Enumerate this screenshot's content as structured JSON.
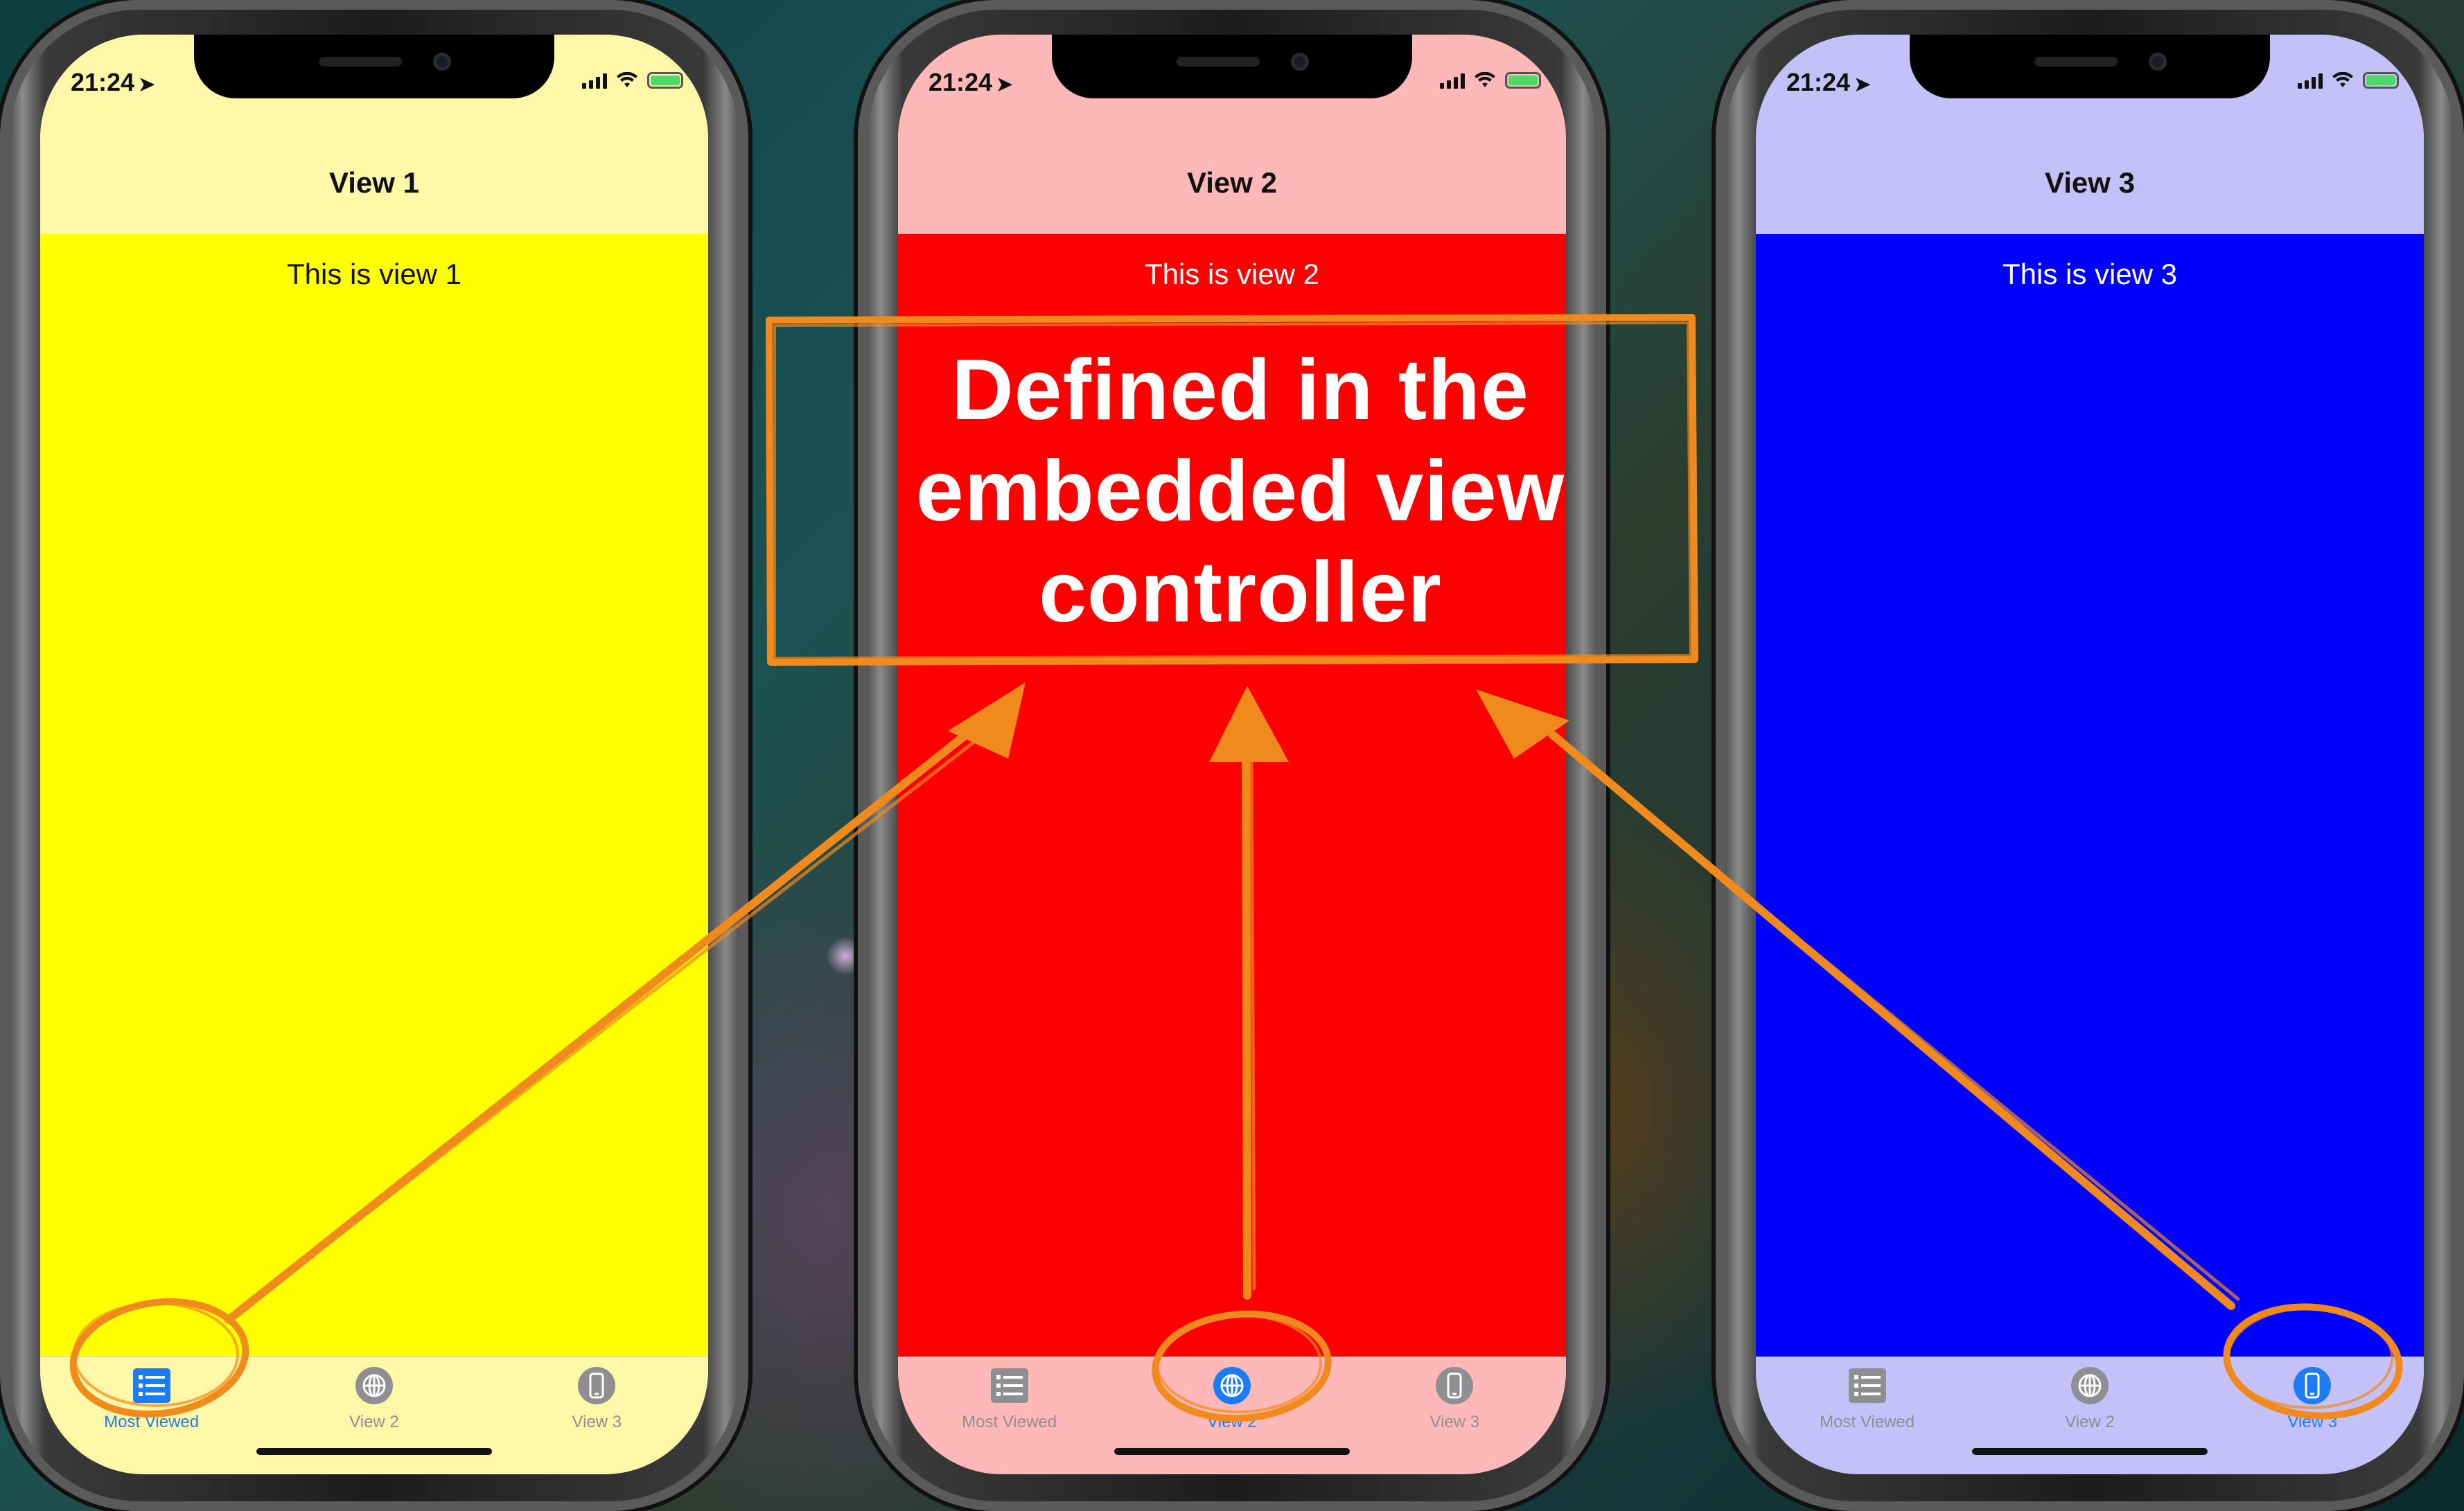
{
  "phones": [
    {
      "time": "21:24",
      "nav_title": "View 1",
      "content_text": "This is view 1",
      "navbar_color": "#fff7a8",
      "content_color": "#ffff00",
      "content_text_color": "#111111",
      "tabbar_color": "#fff7a8",
      "selected_tab": 0,
      "tabs": [
        {
          "label": "Most Viewed",
          "icon": "list-icon"
        },
        {
          "label": "View 2",
          "icon": "globe-icon"
        },
        {
          "label": "View 3",
          "icon": "phone-icon"
        }
      ]
    },
    {
      "time": "21:24",
      "nav_title": "View 2",
      "content_text": "This is view 2",
      "navbar_color": "#ffb8b8",
      "content_color": "#ff0000",
      "content_text_color": "#ffffff",
      "tabbar_color": "#ffb8b8",
      "selected_tab": 1,
      "tabs": [
        {
          "label": "Most Viewed",
          "icon": "list-icon"
        },
        {
          "label": "View 2",
          "icon": "globe-icon"
        },
        {
          "label": "View 3",
          "icon": "phone-icon"
        }
      ]
    },
    {
      "time": "21:24",
      "nav_title": "View 3",
      "content_text": "This is view 3",
      "navbar_color": "#c4c0f8",
      "content_color": "#0000ff",
      "content_text_color": "#ffffff",
      "tabbar_color": "#c4c0f8",
      "selected_tab": 2,
      "tabs": [
        {
          "label": "Most Viewed",
          "icon": "list-icon"
        },
        {
          "label": "View 2",
          "icon": "globe-icon"
        },
        {
          "label": "View 3",
          "icon": "phone-icon"
        }
      ]
    }
  ],
  "annotation": {
    "line1": "Defined in the",
    "line2": "embedded view",
    "line3": "controller",
    "color": "#f08a1c"
  },
  "colors": {
    "tab_selected": "#1e7cf2",
    "tab_unselected": "#8e8e93"
  }
}
